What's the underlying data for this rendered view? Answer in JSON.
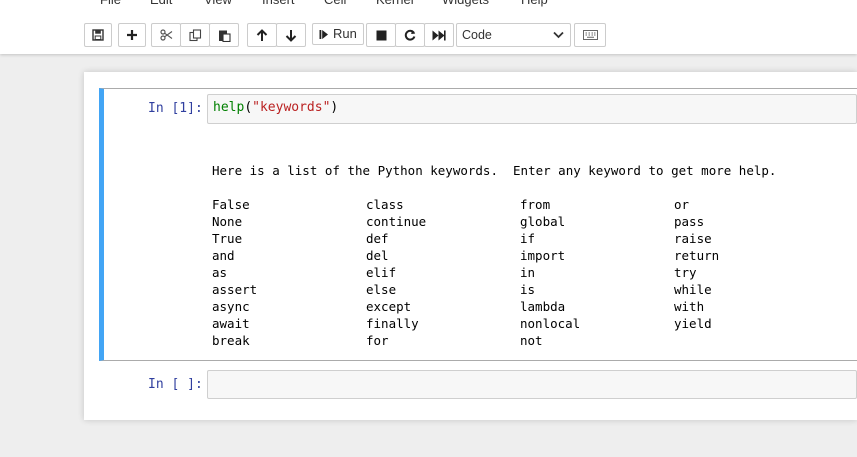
{
  "menu": [
    "File",
    "Edit",
    "View",
    "Insert",
    "Cell",
    "Kernel",
    "Widgets",
    "Help"
  ],
  "toolbar": {
    "run_label": "Run",
    "cell_type": "Code"
  },
  "cells": [
    {
      "prompt": "In [1]:",
      "code": {
        "fn": "help",
        "open": "(",
        "arg": "\"keywords\"",
        "close": ")"
      },
      "output": {
        "intro": "Here is a list of the Python keywords.  Enter any keyword to get more help.",
        "columns": [
          [
            "False",
            "None",
            "True",
            "and",
            "as",
            "assert",
            "async",
            "await",
            "break"
          ],
          [
            "class",
            "continue",
            "def",
            "del",
            "elif",
            "else",
            "except",
            "finally",
            "for"
          ],
          [
            "from",
            "global",
            "if",
            "import",
            "in",
            "is",
            "lambda",
            "nonlocal",
            "not"
          ],
          [
            "or",
            "pass",
            "raise",
            "return",
            "try",
            "while",
            "with",
            "yield"
          ]
        ]
      }
    },
    {
      "prompt": "In [ ]:",
      "code": ""
    }
  ]
}
